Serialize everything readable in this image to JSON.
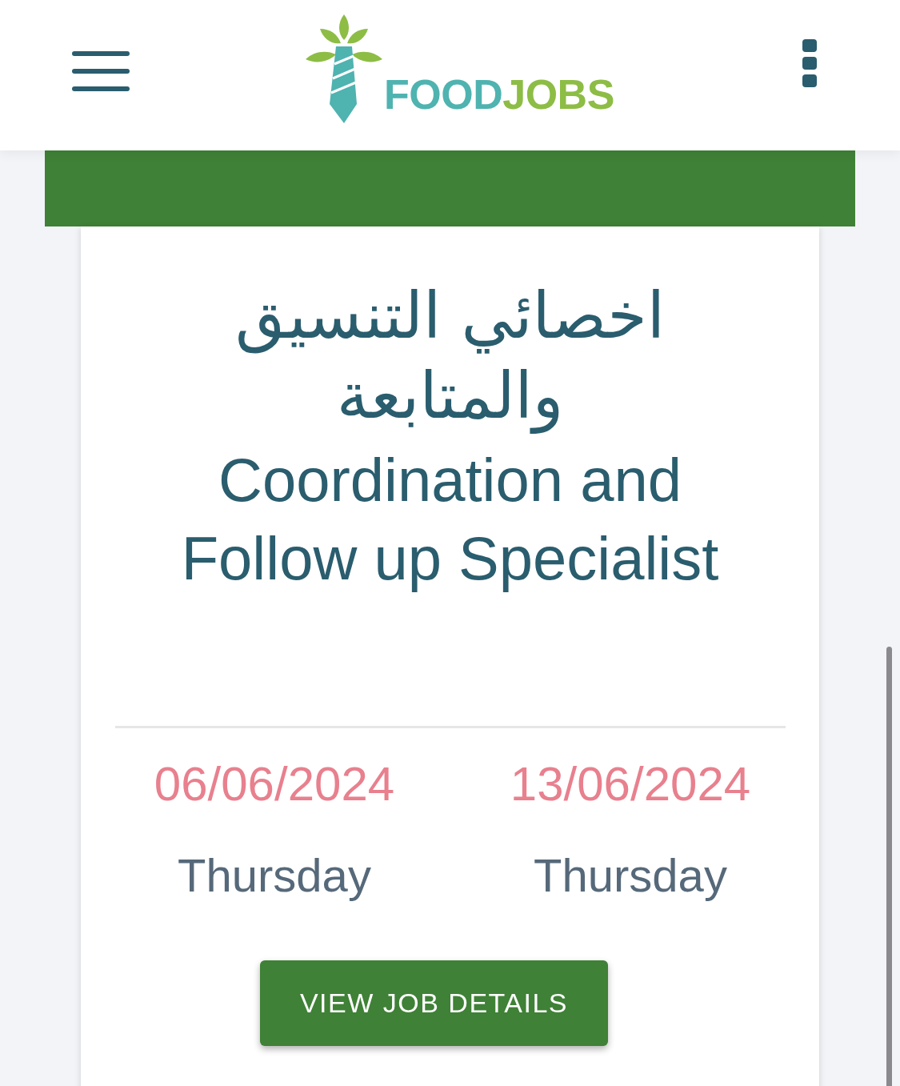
{
  "header": {
    "logo": {
      "parts": [
        "FOOD",
        "JOBS"
      ]
    }
  },
  "job_card": {
    "title_ar": "اخصائي التنسيق والمتابعة",
    "title_en": "Coordination and Follow up Specialist",
    "dates": [
      {
        "date": "06/06/2024",
        "day": "Thursday"
      },
      {
        "date": "13/06/2024",
        "day": "Thursday"
      }
    ],
    "button": "VIEW JOB DETAILS"
  }
}
